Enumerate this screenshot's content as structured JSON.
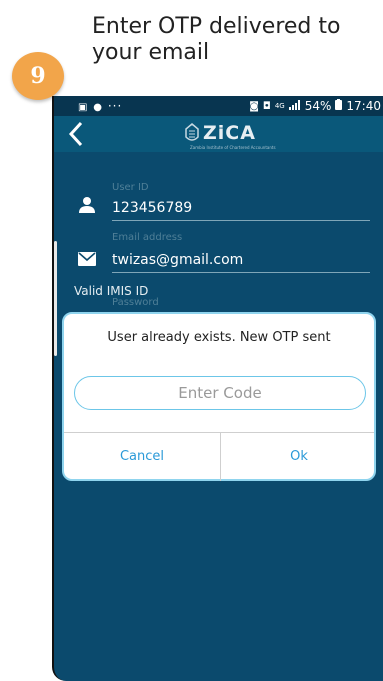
{
  "tutorial": {
    "step_number": "9",
    "caption": "Enter OTP delivered to your email"
  },
  "status_bar": {
    "left": "···",
    "network": "4G",
    "battery": "54%",
    "time": "17:40"
  },
  "app_bar": {
    "back_icon": "chevron-left-icon",
    "logo_text": "ZiCA",
    "logo_subtitle": "Zambia Institute of Chartered Accountants"
  },
  "form": {
    "user_id_label": "User ID",
    "user_id_value": "123456789",
    "email_label": "Email address",
    "email_value": "twizas@gmail.com",
    "imis_label": "Valid IMIS ID",
    "password_label": "Password"
  },
  "dialog": {
    "message": "User already exists. New OTP sent",
    "code_placeholder": "Enter Code",
    "cancel_label": "Cancel",
    "ok_label": "Ok"
  },
  "colors": {
    "badge": "#f2a54a",
    "screen_bg": "#0b4a6d",
    "app_bar": "#0a587a",
    "dialog_border": "#8fd4ee",
    "button_text": "#2b9ad8"
  }
}
